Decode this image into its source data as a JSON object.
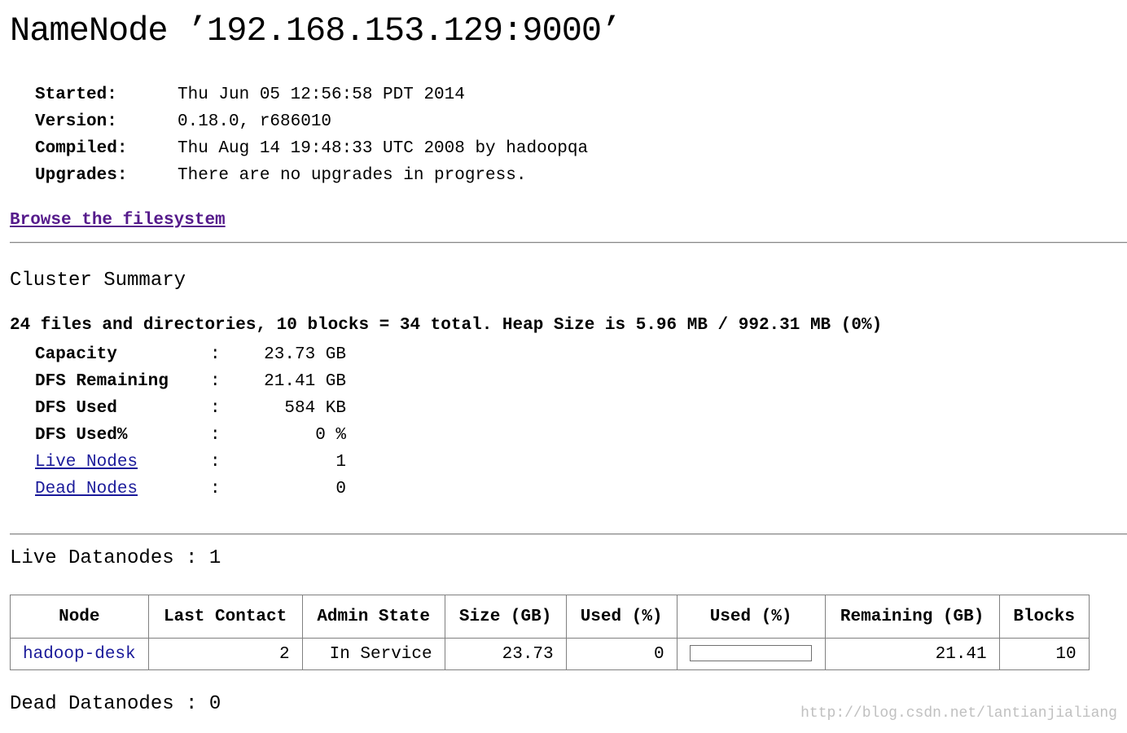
{
  "title": "NameNode ’192.168.153.129:9000’",
  "info": [
    {
      "label": "Started:",
      "value": "Thu Jun 05 12:56:58 PDT 2014"
    },
    {
      "label": "Version:",
      "value": "0.18.0, r686010"
    },
    {
      "label": "Compiled:",
      "value": "Thu Aug 14 19:48:33 UTC 2008 by hadoopqa"
    },
    {
      "label": "Upgrades:",
      "value": "There are no upgrades in progress."
    }
  ],
  "browse_link": "Browse the filesystem",
  "cluster_summary": {
    "heading": "Cluster Summary",
    "summary_line": "24 files and directories, 10 blocks = 34 total. Heap Size is 5.96 MB / 992.31 MB (0%)",
    "separator": ":",
    "stats": [
      {
        "label": "Capacity",
        "value": "23.73 GB"
      },
      {
        "label": "DFS Remaining",
        "value": "21.41 GB"
      },
      {
        "label": "DFS Used",
        "value": "584 KB"
      },
      {
        "label": "DFS Used%",
        "value": "0 %"
      },
      {
        "label": "Live Nodes",
        "value": "1"
      },
      {
        "label": "Dead Nodes",
        "value": "0"
      }
    ]
  },
  "live_datanodes": {
    "heading": "Live Datanodes : 1",
    "columns": [
      "Node",
      "Last Contact",
      "Admin State",
      "Size (GB)",
      "Used (%)",
      "Used (%)",
      "Remaining (GB)",
      "Blocks"
    ],
    "rows": [
      {
        "node": "hadoop-desk",
        "last_contact": "2",
        "admin_state": "In Service",
        "size_gb": "23.73",
        "used_pct": "0",
        "used_bar_fraction": 0,
        "remaining_gb": "21.41",
        "blocks": "10"
      }
    ]
  },
  "dead_datanodes": {
    "heading": "Dead Datanodes : 0"
  },
  "watermark": "http://blog.csdn.net/lantianjialiang",
  "colors": {
    "link": "#1a1a9a",
    "visited_link": "#551a8b",
    "rule": "#888888",
    "table_border": "#808080",
    "watermark": "#c0c0c0"
  }
}
